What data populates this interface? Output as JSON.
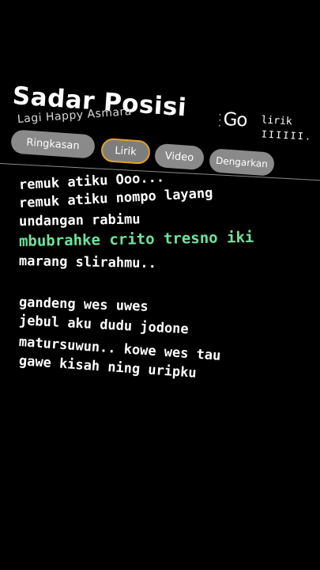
{
  "header": {
    "title": "Sadar Posisi",
    "subtitle": "Lagi Happy Asmara",
    "brand_go": "Go",
    "brand_lirik": "lirik",
    "brand_bars": "IIIIII."
  },
  "tabs": [
    {
      "label": "Ringkasan",
      "active": false
    },
    {
      "label": "Lirik",
      "active": true
    },
    {
      "label": "Video",
      "active": false
    },
    {
      "label": "Dengarkan",
      "active": false
    }
  ],
  "lyrics": {
    "lines": [
      "remuk atiku Ooo...",
      "remuk atiku nompo layang",
      "undangan rabimu",
      "mbubrahke crito tresno iki",
      "marang slirahmu..",
      "gandeng wes uwes",
      "jebul aku dudu jodone",
      "matursuwun.. kowe wes tau",
      "gawe kisah ning uripku"
    ],
    "highlight_color": "#6ee39a"
  }
}
